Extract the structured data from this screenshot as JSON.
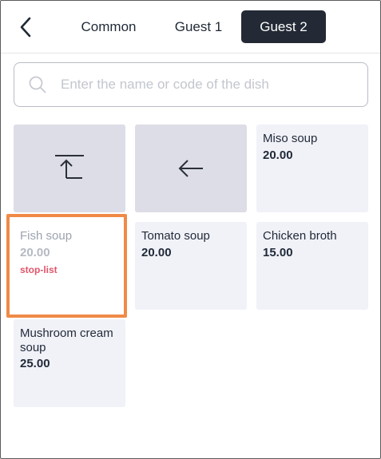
{
  "header": {
    "tabs": [
      {
        "label": "Common",
        "active": false
      },
      {
        "label": "Guest 1",
        "active": false
      },
      {
        "label": "Guest 2",
        "active": true
      }
    ],
    "active_tab_color": "#232a35"
  },
  "search": {
    "placeholder": "Enter the name or code of the dish",
    "value": ""
  },
  "icons": {
    "back": "chevron-left-icon",
    "search": "search-icon",
    "up_level": "arrow-up-to-top-icon",
    "previous": "arrow-left-icon"
  },
  "dishes": [
    {
      "name": "Miso soup",
      "price": "20.00"
    },
    {
      "name": "Fish soup",
      "price": "20.00",
      "status": "stop-list"
    },
    {
      "name": "Tomato soup",
      "price": "20.00"
    },
    {
      "name": "Chicken broth",
      "price": "15.00"
    },
    {
      "name": "Mushroom cream soup",
      "price": "25.00"
    }
  ],
  "colors": {
    "highlight": "#f08a47",
    "stop_list": "#e0556a",
    "tile_bg": "#f1f1f8",
    "action_tile_bg": "#dcdde6"
  }
}
